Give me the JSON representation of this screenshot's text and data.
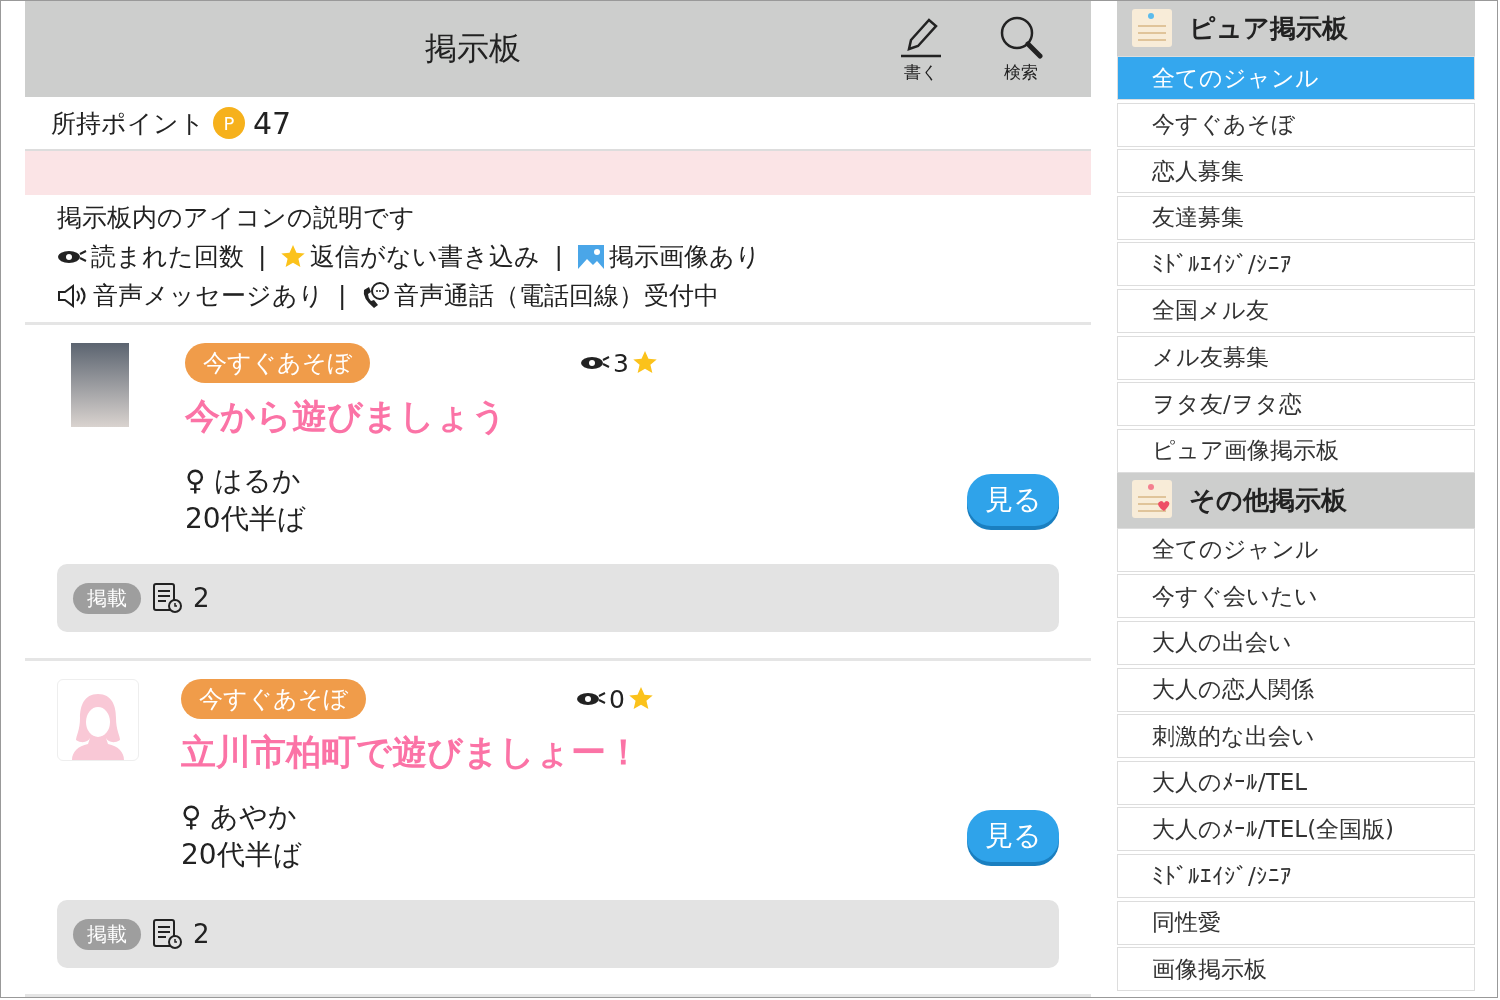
{
  "header": {
    "title": "掲示板",
    "actions": [
      {
        "kind": "write",
        "label": "書く"
      },
      {
        "kind": "search",
        "label": "検索"
      }
    ]
  },
  "points": {
    "label": "所持ポイント",
    "badge": "P",
    "value": "47"
  },
  "legend": {
    "intro": "掲示板内のアイコンの説明です",
    "separator": "|",
    "rows": [
      [
        {
          "kind": "eye",
          "text": "読まれた回数"
        },
        {
          "kind": "star",
          "text": "返信がない書き込み"
        },
        {
          "kind": "image",
          "text": "掲示画像あり"
        }
      ],
      [
        {
          "kind": "speaker",
          "text": "音声メッセージあり"
        },
        {
          "kind": "phone",
          "text": "音声通話（電話回線）受付中"
        }
      ]
    ]
  },
  "posts": [
    {
      "avatar": {
        "kind": "photo"
      },
      "category": "今すぐあそぼ",
      "views": "3",
      "unreplied": true,
      "title": "今から遊びましょう",
      "gender": "♀",
      "name": "はるか",
      "age": "20代半ば",
      "button": "見る",
      "tag": "掲載",
      "count": "2"
    },
    {
      "avatar": {
        "kind": "silhouette"
      },
      "category": "今すぐあそぼ",
      "views": "0",
      "unreplied": true,
      "title": "立川市柏町で遊びましょー！",
      "gender": "♀",
      "name": "あやか",
      "age": "20代半ば",
      "button": "見る",
      "tag": "掲載",
      "count": "2"
    }
  ],
  "sidebar": [
    {
      "kind": "pure",
      "title": "ピュア掲示板",
      "items": [
        {
          "label": "全てのジャンル",
          "selected": true
        },
        {
          "label": "今すぐあそぼ",
          "selected": false
        },
        {
          "label": "恋人募集",
          "selected": false
        },
        {
          "label": "友達募集",
          "selected": false
        },
        {
          "label": "ﾐﾄﾞﾙｴｲｼﾞ/ｼﾆｱ",
          "selected": false
        },
        {
          "label": "全国メル友",
          "selected": false
        },
        {
          "label": "メル友募集",
          "selected": false
        },
        {
          "label": "ヲタ友/ヲタ恋",
          "selected": false
        },
        {
          "label": "ピュア画像掲示板",
          "selected": false
        }
      ]
    },
    {
      "kind": "other",
      "title": "その他掲示板",
      "items": [
        {
          "label": "全てのジャンル",
          "selected": false
        },
        {
          "label": "今すぐ会いたい",
          "selected": false
        },
        {
          "label": "大人の出会い",
          "selected": false
        },
        {
          "label": "大人の恋人関係",
          "selected": false
        },
        {
          "label": "刺激的な出会い",
          "selected": false
        },
        {
          "label": "大人のﾒｰﾙ/TEL",
          "selected": false
        },
        {
          "label": "大人のﾒｰﾙ/TEL(全国版)",
          "selected": false
        },
        {
          "label": "ﾐﾄﾞﾙｴｲｼﾞ/ｼﾆｱ",
          "selected": false
        },
        {
          "label": "同性愛",
          "selected": false
        },
        {
          "label": "画像掲示板",
          "selected": false
        }
      ]
    }
  ]
}
